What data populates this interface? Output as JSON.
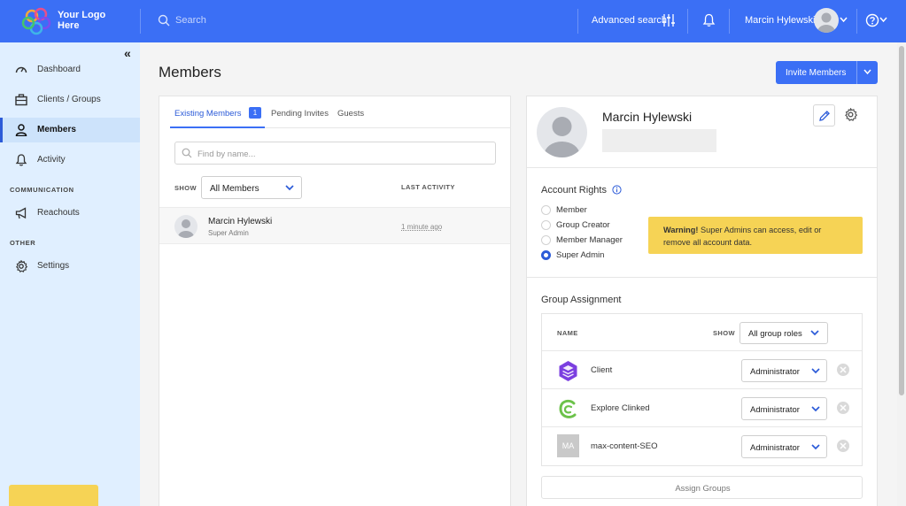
{
  "brand": {
    "logo_text": "Your Logo Here",
    "accent": "#3b6ff5"
  },
  "topbar": {
    "search_placeholder": "Search",
    "advanced_search": "Advanced search",
    "user_name": "Marcin Hylewski"
  },
  "sidebar": {
    "items": [
      {
        "label": "Dashboard",
        "icon": "gauge-icon"
      },
      {
        "label": "Clients / Groups",
        "icon": "briefcase-icon"
      },
      {
        "label": "Members",
        "icon": "person-icon",
        "active": true
      },
      {
        "label": "Activity",
        "icon": "bell-icon"
      }
    ],
    "section_communication": "COMMUNICATION",
    "reachouts": "Reachouts",
    "section_other": "OTHER",
    "settings": "Settings"
  },
  "page": {
    "title": "Members",
    "invite_button": "Invite Members"
  },
  "members_panel": {
    "tabs": [
      {
        "label": "Existing Members",
        "count": "1",
        "active": true
      },
      {
        "label": "Pending Invites"
      },
      {
        "label": "Guests"
      }
    ],
    "find_placeholder": "Find by name...",
    "show_label": "SHOW",
    "show_value": "All Members",
    "last_activity_label": "LAST ACTIVITY",
    "rows": [
      {
        "name": "Marcin Hylewski",
        "role": "Super Admin",
        "last_activity": "1 minute ago"
      }
    ]
  },
  "detail_panel": {
    "name": "Marcin Hylewski",
    "account_rights_title": "Account Rights",
    "rights": [
      {
        "label": "Member",
        "checked": false
      },
      {
        "label": "Group Creator",
        "checked": false
      },
      {
        "label": "Member Manager",
        "checked": false
      },
      {
        "label": "Super Admin",
        "checked": true
      }
    ],
    "warning_bold": "Warning!",
    "warning_text": " Super Admins can access, edit or remove all account data.",
    "warning_color": "#f6d355",
    "group_assignment_title": "Group Assignment",
    "name_col": "NAME",
    "show_label": "SHOW",
    "show_value": "All group roles",
    "groups": [
      {
        "name": "Client",
        "role": "Administrator",
        "icon": "layers-hex-icon"
      },
      {
        "name": "Explore Clinked",
        "role": "Administrator",
        "icon": "clinked-logo-icon"
      },
      {
        "name": "max-content-SEO",
        "role": "Administrator",
        "badge": "MA"
      }
    ],
    "assign_button": "Assign Groups"
  }
}
